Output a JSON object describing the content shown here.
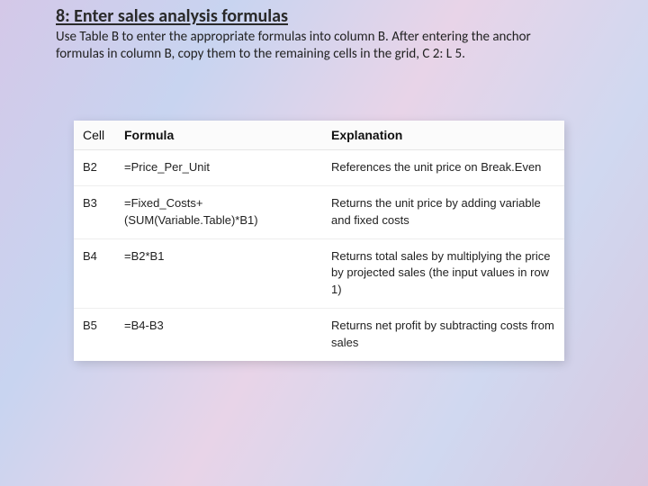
{
  "heading": "8: Enter sales analysis formulas",
  "description": "Use Table B to enter the appropriate formulas into column B. After entering the anchor formulas in column B, copy them to the remaining cells in the grid, C 2: L 5.",
  "table": {
    "headers": {
      "cell": "Cell",
      "formula": "Formula",
      "explanation": "Explanation"
    },
    "rows": [
      {
        "cell": "B2",
        "formula": "=Price_Per_Unit",
        "explanation": "References the unit price on Break.Even"
      },
      {
        "cell": "B3",
        "formula": "=Fixed_Costs+(SUM(Variable.Table)*B1)",
        "explanation": "Returns the unit price by adding variable and fixed costs"
      },
      {
        "cell": "B4",
        "formula": "=B2*B1",
        "explanation": "Returns total sales by multiplying the price by projected sales (the input values in row 1)"
      },
      {
        "cell": "B5",
        "formula": "=B4-B3",
        "explanation": "Returns net profit by subtracting costs from sales"
      }
    ]
  }
}
